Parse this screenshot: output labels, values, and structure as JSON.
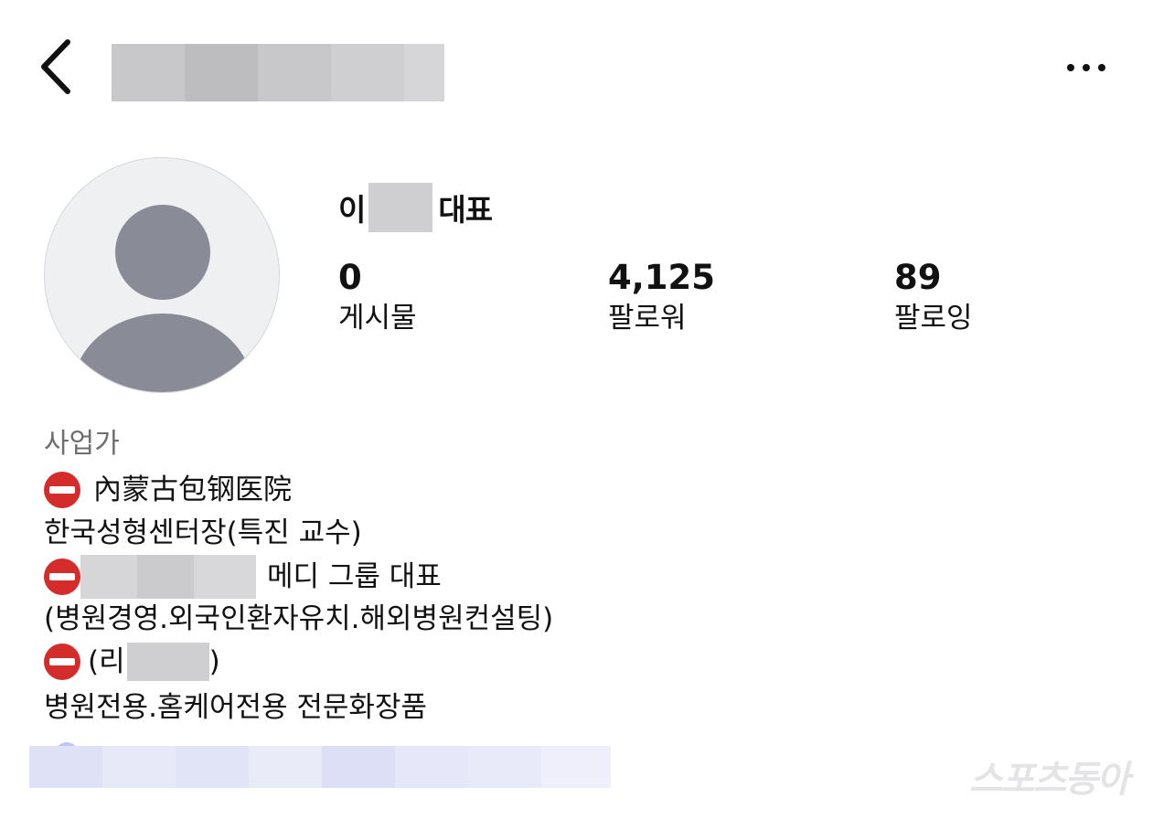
{
  "profile": {
    "name_prefix": "이",
    "name_suffix": "대표",
    "stats": [
      {
        "value": "0",
        "label": "게시물"
      },
      {
        "value": "4,125",
        "label": "팔로워"
      },
      {
        "value": "89",
        "label": "팔로잉"
      }
    ]
  },
  "bio": {
    "category": "사업가",
    "line1": "內蒙古包钢医院",
    "line2": "한국성형센터장(특진 교수)",
    "line3_suffix": "메디 그룹 대표",
    "line4": "(병원경영.외국인환자유치.해외병원컨설팅)",
    "line5_prefix": "(리",
    "line5_suffix": ")",
    "line6": "병원전용.홈케어전용 전문화장품"
  },
  "icons": {
    "back": "chevron-left-icon",
    "more": "more-horizontal-icon",
    "bullet": "no-entry-emoji-icon"
  },
  "colors": {
    "no_entry_red": "#d42b2b",
    "redaction_gray": "#cfcfd2",
    "link_blur_blue": "#e2e4f8"
  },
  "watermark": "스포츠동아"
}
